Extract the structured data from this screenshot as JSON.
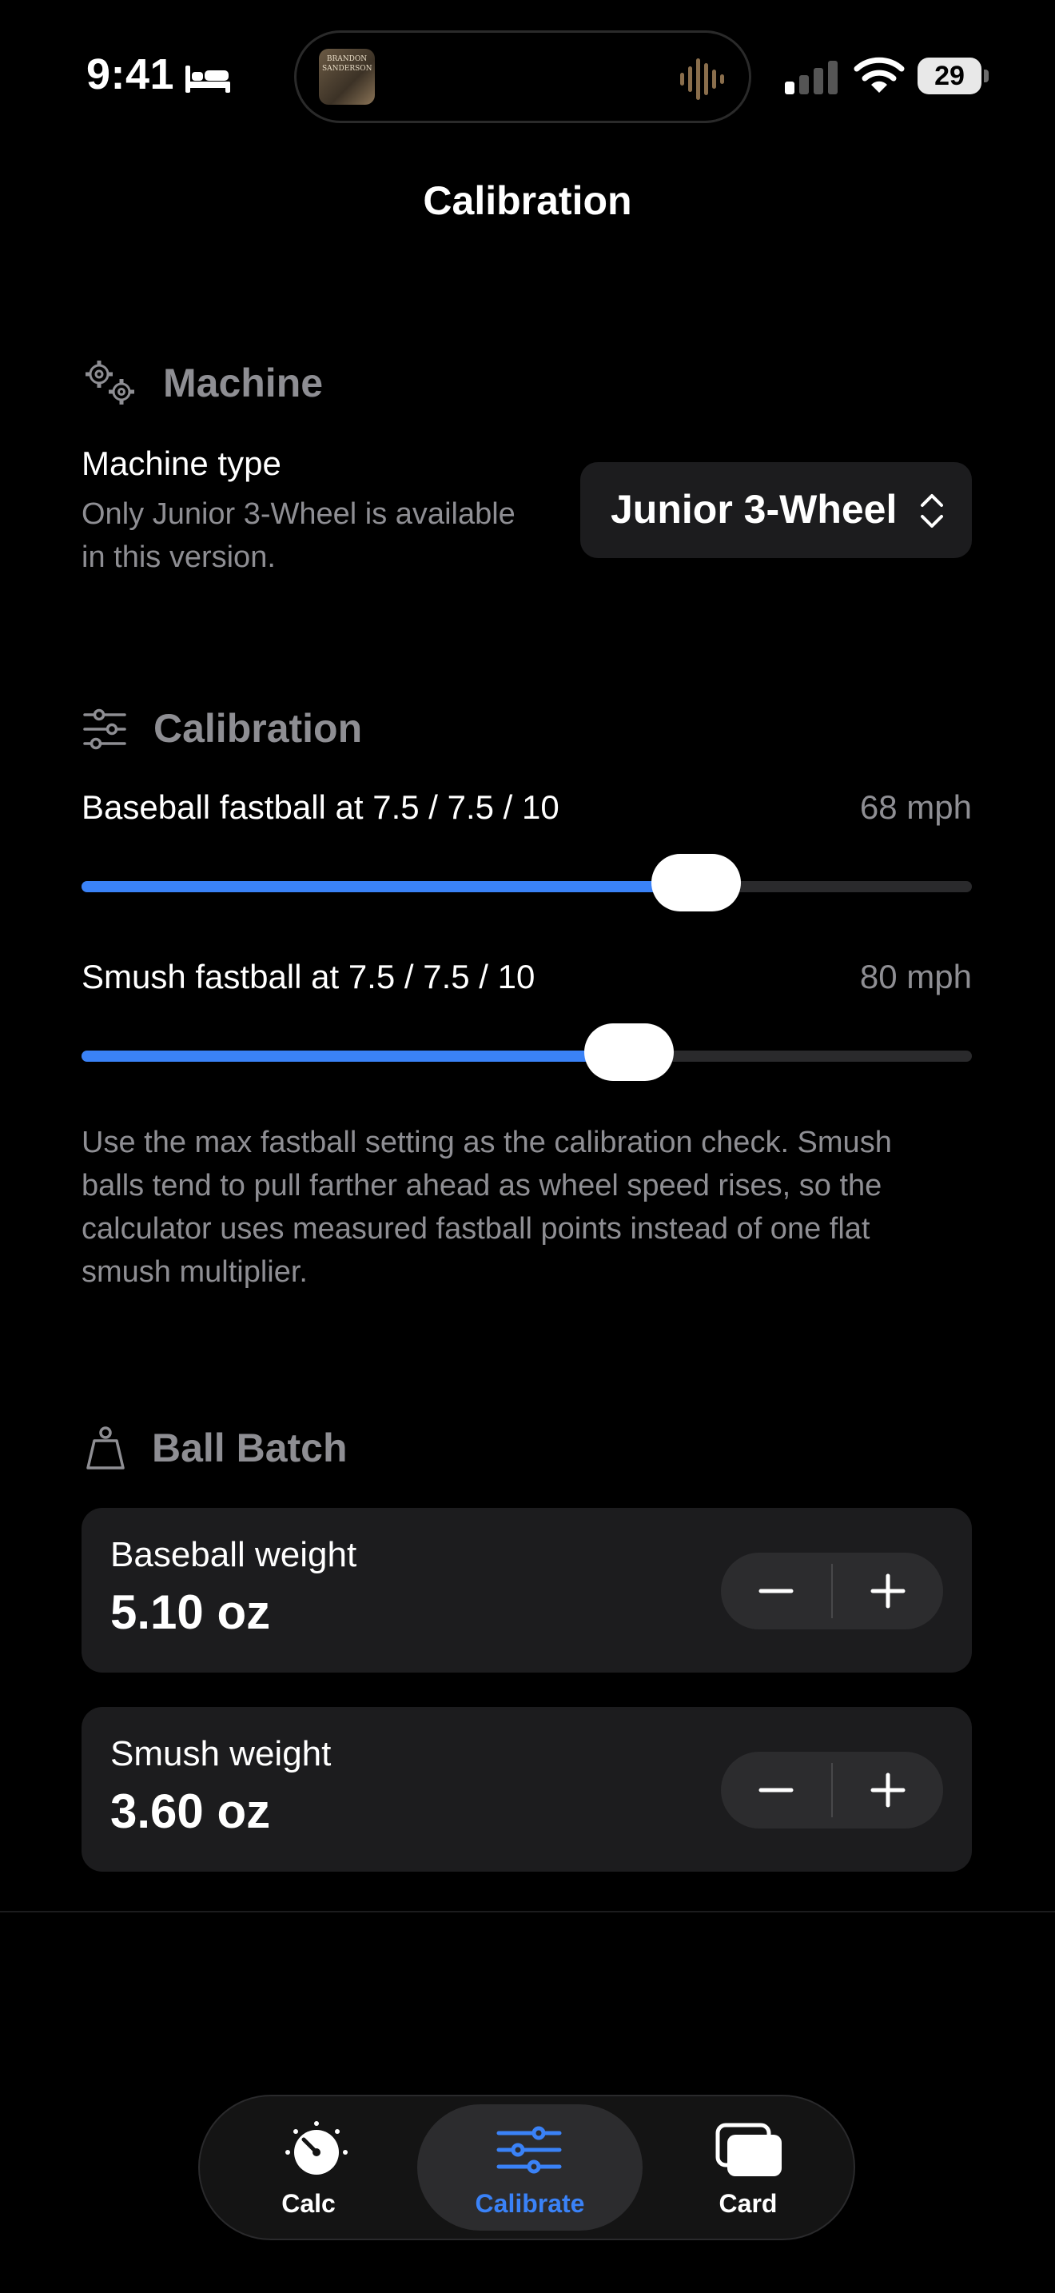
{
  "status_bar": {
    "time": "9:41",
    "battery": "29",
    "album_line1": "BRANDON",
    "album_line2": "SANDERSON"
  },
  "nav": {
    "title": "Calibration"
  },
  "machine": {
    "header": "Machine",
    "type_label": "Machine type",
    "type_note_line1": "Only Junior 3-Wheel is available",
    "type_note_line2": "in this version.",
    "picker_value": "Junior 3-Wheel"
  },
  "calibration": {
    "header": "Calibration",
    "sliders": [
      {
        "label": "Baseball fastball at 7.5 / 7.5 / 10",
        "value": "68 mph",
        "fraction": 0.69
      },
      {
        "label": "Smush fastball at 7.5 / 7.5 / 10",
        "value": "80 mph",
        "fraction": 0.615
      }
    ],
    "help_line1": "Use the max fastball setting as the calibration check. Smush",
    "help_line2": "balls tend to pull farther ahead as wheel speed rises, so the",
    "help_line3": "calculator uses measured fastball points instead of one flat",
    "help_line4": "smush multiplier."
  },
  "ball_batch": {
    "header": "Ball Batch",
    "cards": [
      {
        "label": "Baseball weight",
        "value": "5.10 oz"
      },
      {
        "label": "Smush weight",
        "value": "3.60 oz"
      }
    ]
  },
  "tabbar": {
    "tabs": [
      {
        "label": "Calc",
        "icon": "gauge-icon"
      },
      {
        "label": "Calibrate",
        "icon": "sliders-icon"
      },
      {
        "label": "Card",
        "icon": "cards-icon"
      }
    ],
    "selected": "Calibrate"
  },
  "colors": {
    "accent": "#3a82f7",
    "background": "#000000",
    "card": "#1c1c1e"
  }
}
